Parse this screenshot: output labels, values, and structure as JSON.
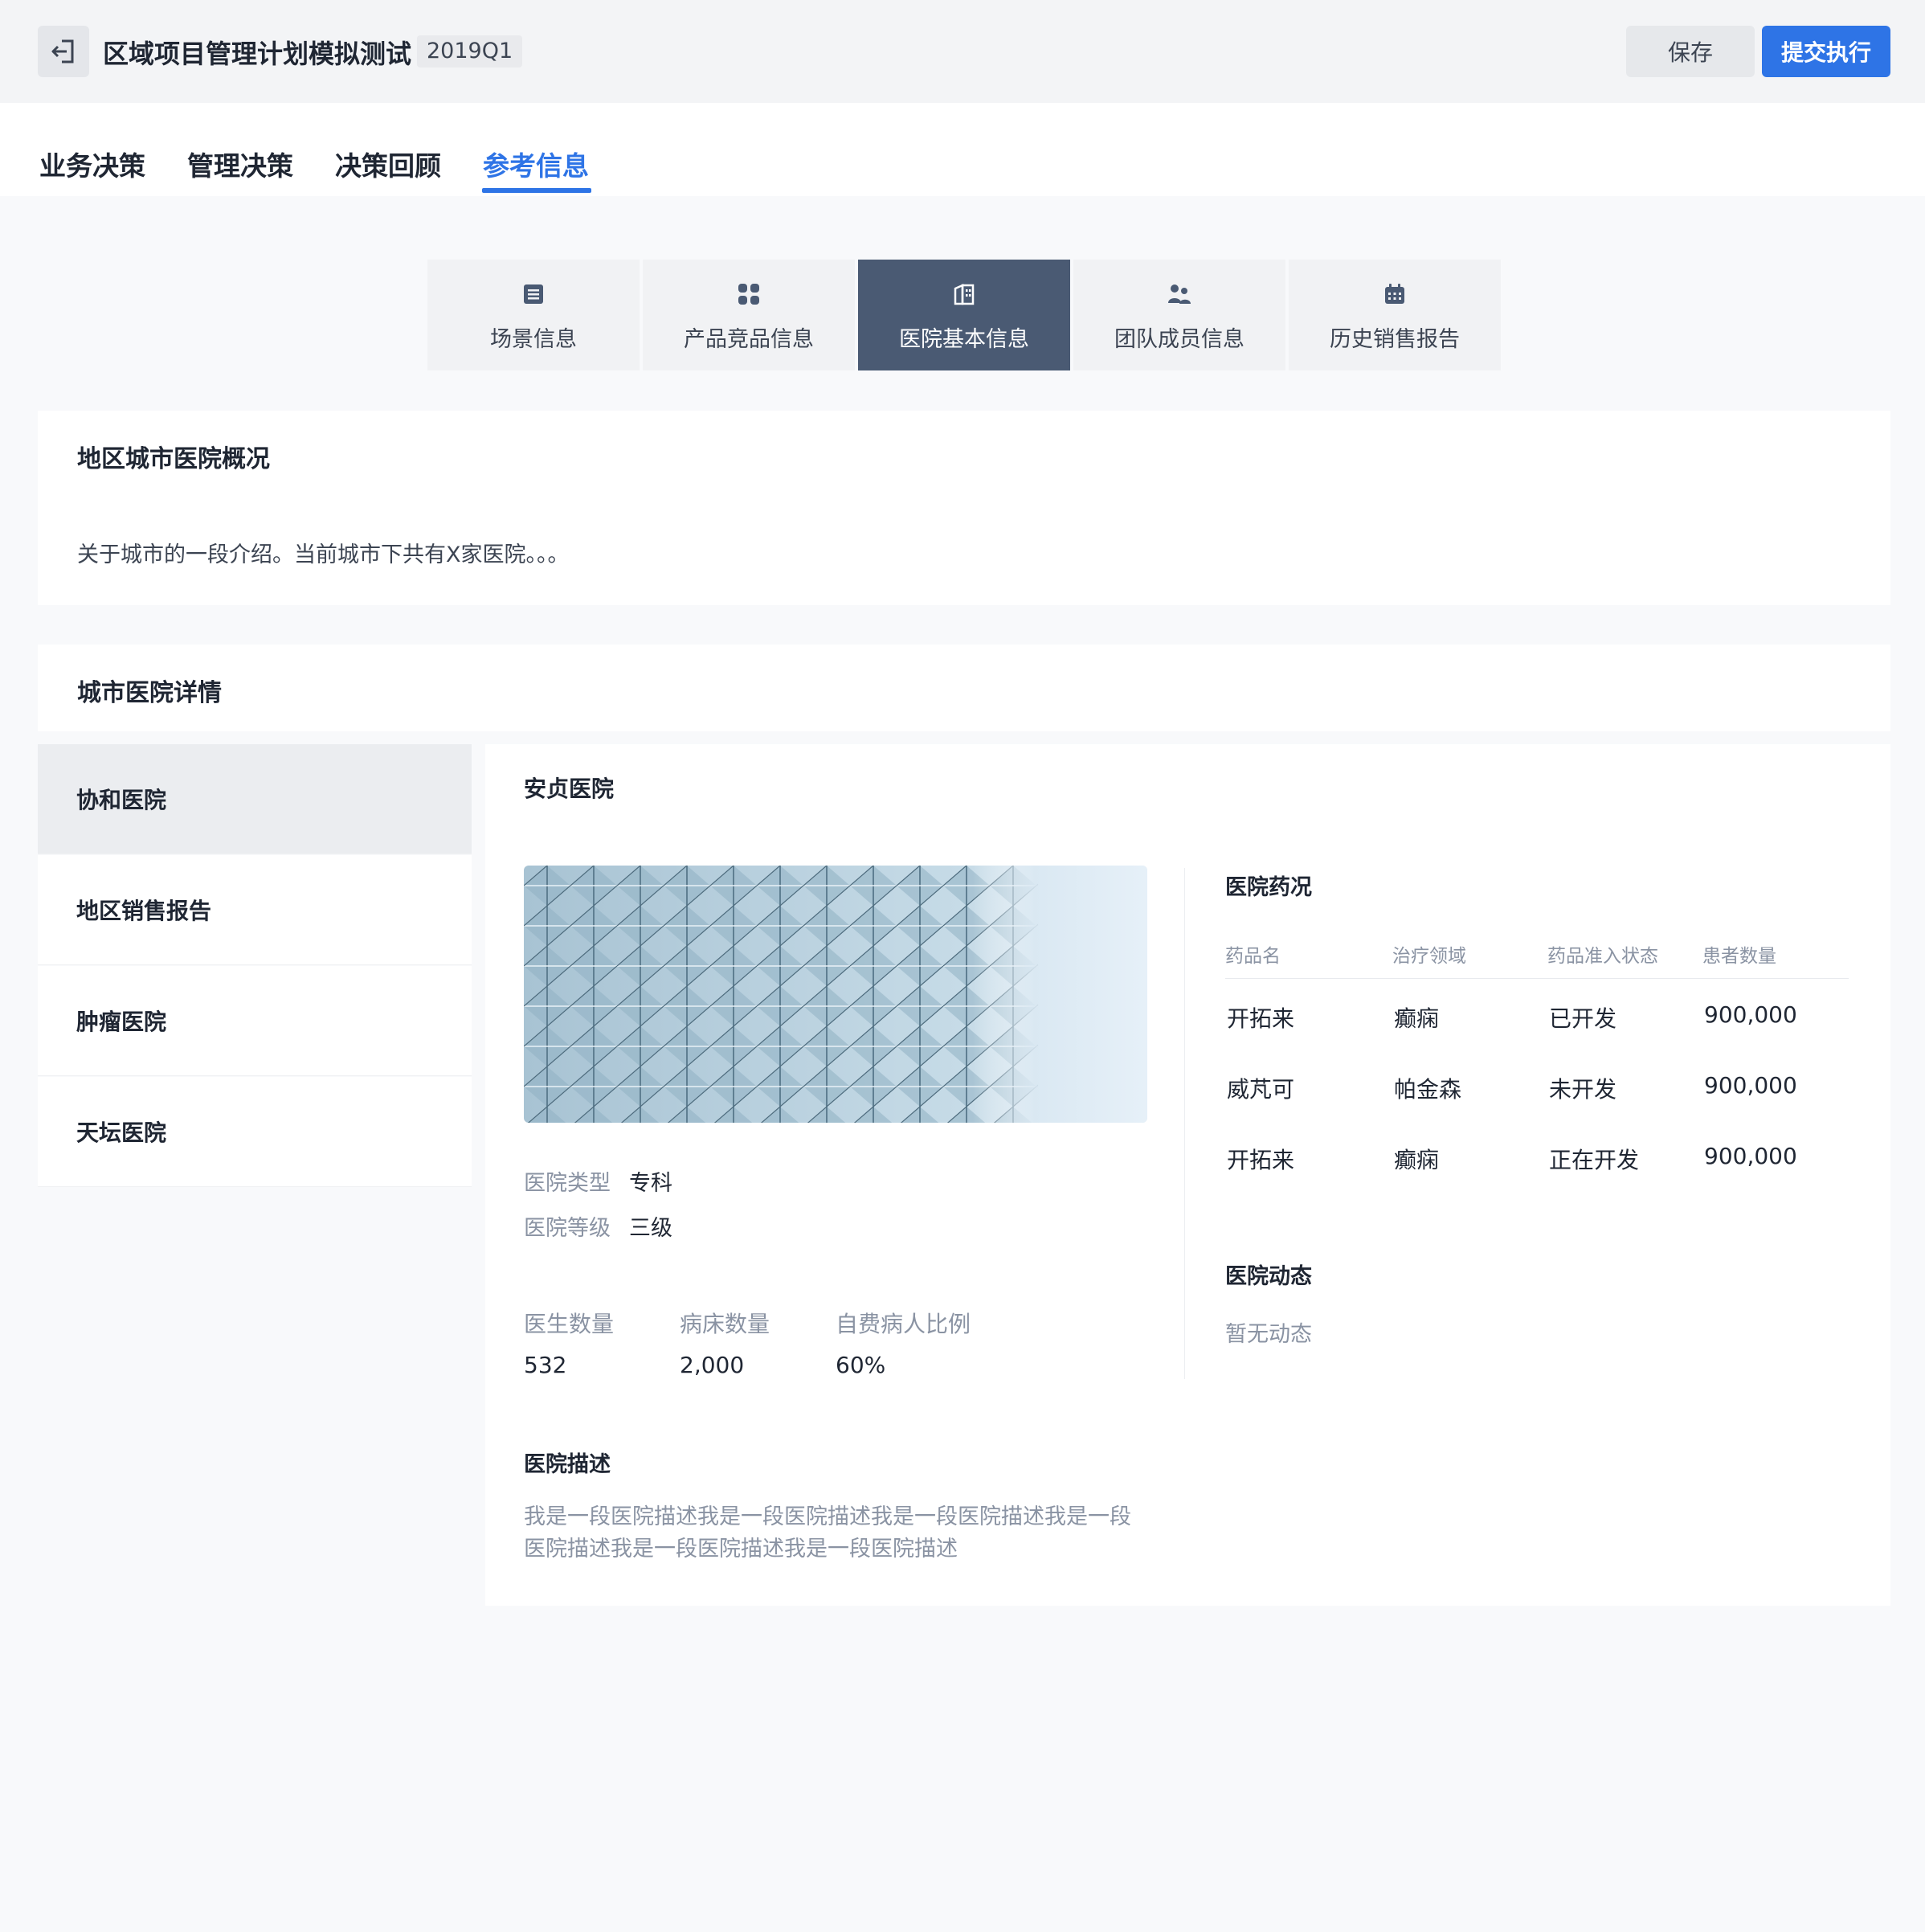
{
  "header": {
    "title": "区域项目管理计划模拟测试",
    "period": "2019Q1",
    "save_label": "保存",
    "submit_label": "提交执行"
  },
  "main_tabs": [
    {
      "label": "业务决策"
    },
    {
      "label": "管理决策"
    },
    {
      "label": "决策回顾"
    },
    {
      "label": "参考信息",
      "active": true
    }
  ],
  "sub_tabs": [
    {
      "label": "场景信息",
      "icon": "list-icon"
    },
    {
      "label": "产品竞品信息",
      "icon": "grid-icon"
    },
    {
      "label": "医院基本信息",
      "icon": "building-icon",
      "active": true
    },
    {
      "label": "团队成员信息",
      "icon": "team-icon"
    },
    {
      "label": "历史销售报告",
      "icon": "calendar-icon"
    }
  ],
  "overview": {
    "title": "地区城市医院概况",
    "text": "关于城市的一段介绍。当前城市下共有X家医院。。。"
  },
  "details": {
    "title": "城市医院详情",
    "hospital_list": [
      {
        "label": "协和医院",
        "active": true
      },
      {
        "label": "地区销售报告"
      },
      {
        "label": "肿瘤医院"
      },
      {
        "label": "天坛医院"
      }
    ]
  },
  "hospital": {
    "name": "安贞医院",
    "type_label": "医院类型",
    "type_value": "专科",
    "level_label": "医院等级",
    "level_value": "三级",
    "stats": [
      {
        "label": "医生数量",
        "value": "532"
      },
      {
        "label": "病床数量",
        "value": "2,000"
      },
      {
        "label": "自费病人比例",
        "value": "60%"
      }
    ],
    "desc_title": "医院描述",
    "desc_text": "我是一段医院描述我是一段医院描述我是一段医院描述我是一段医院描述我是一段医院描述我是一段医院描述",
    "drugs_title": "医院药况",
    "drug_columns": [
      "药品名",
      "治疗领域",
      "药品准入状态",
      "患者数量"
    ],
    "drug_rows": [
      [
        "开拓来",
        "癫痫",
        "已开发",
        "900,000"
      ],
      [
        "威芃可",
        "帕金森",
        "未开发",
        "900,000"
      ],
      [
        "开拓来",
        "癫痫",
        "正在开发",
        "900,000"
      ]
    ],
    "news_title": "医院动态",
    "news_empty": "暂无动态"
  },
  "colors": {
    "accent": "#2e74e6",
    "active_subtab": "#4a5a73",
    "page_bg": "#f8f9fb"
  }
}
